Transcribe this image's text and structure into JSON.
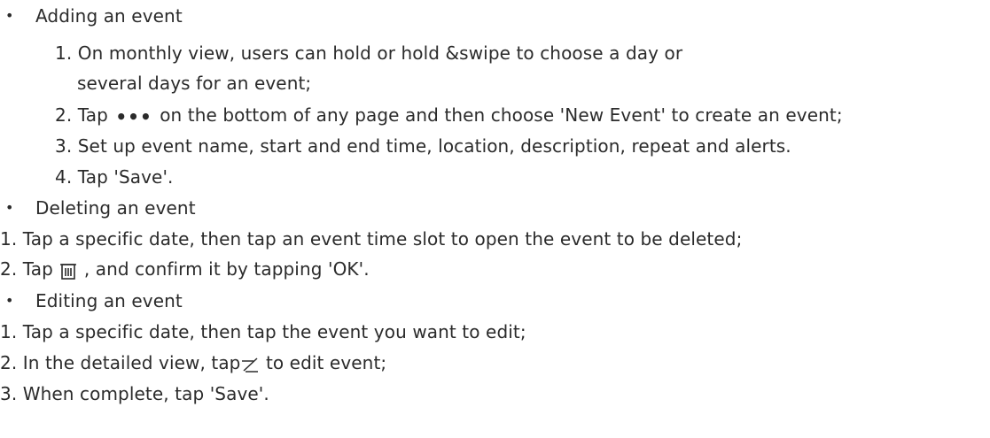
{
  "sections": {
    "adding": {
      "bullet": "•",
      "title": "Adding an event",
      "step1a": "1. On monthly view, users can hold or hold &swipe to choose a day or",
      "step1b": "several days for an event;",
      "step2_pre": "2. Tap",
      "step2_post": "on the bottom of any page and then choose 'New Event' to create an event;",
      "step3": "3. Set up event name, start and end time, location, description, repeat and alerts.",
      "step4": "4. Tap 'Save'."
    },
    "deleting": {
      "bullet": "•",
      "title": "Deleting an event",
      "step1": "1. Tap a specific date, then tap an event time slot to open the event to be deleted;",
      "step2_pre": "2. Tap",
      "step2_post": ", and confirm it by tapping 'OK'."
    },
    "editing": {
      "bullet": "•",
      "title": "Editing an event",
      "step1": "1.  Tap a specific date, then tap the event you want to edit;",
      "step2_pre": "2.  In the detailed view, tap",
      "step2_post": " to edit event;",
      "step3": "3.  When complete, tap 'Save'."
    }
  },
  "icons": {
    "more": "•••",
    "more_icon_name": "more-dots-icon",
    "trash_icon_name": "trash-icon",
    "edit_icon_name": "edit-pencil-icon"
  }
}
